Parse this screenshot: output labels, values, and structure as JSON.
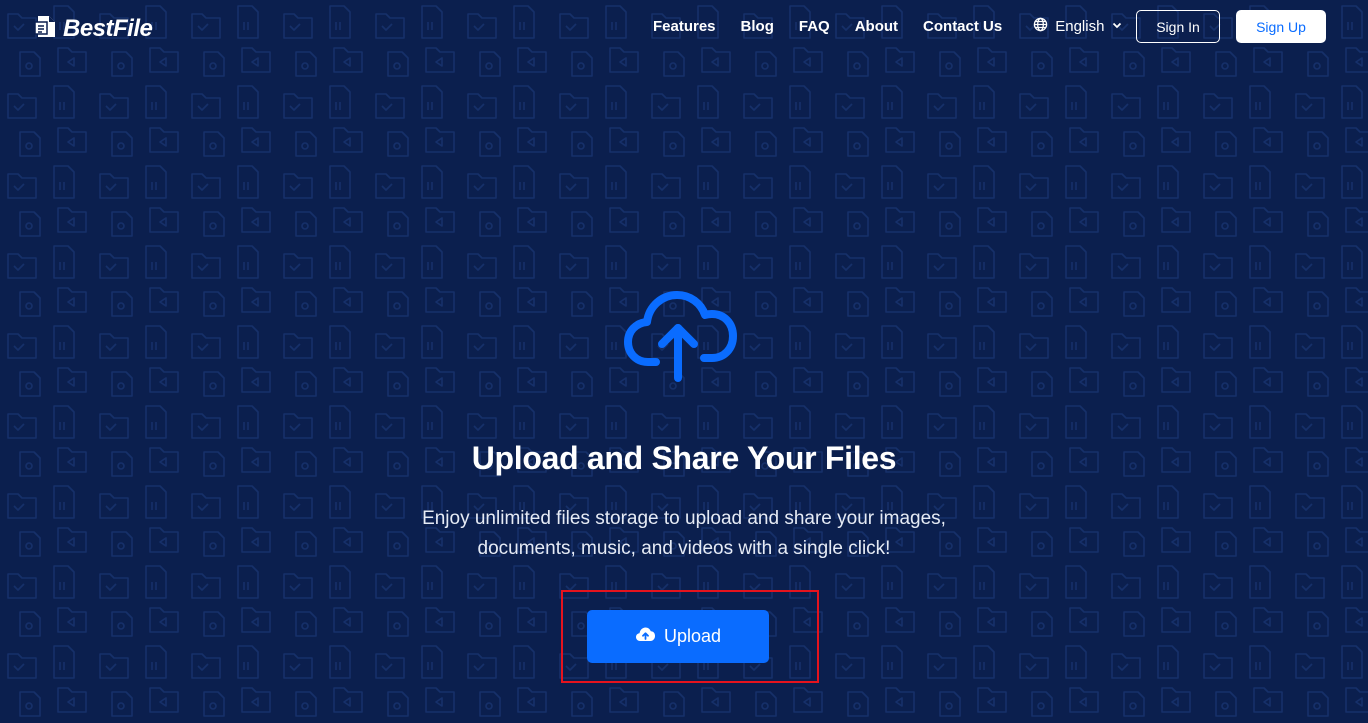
{
  "brand": {
    "name": "BestFile",
    "logo_icon": "file-logo-icon"
  },
  "nav": {
    "links": [
      "Features",
      "Blog",
      "FAQ",
      "About",
      "Contact Us"
    ],
    "language": "English",
    "language_icon": "globe-icon",
    "language_dropdown_icon": "chevron-down-icon"
  },
  "auth": {
    "sign_in": "Sign In",
    "sign_up": "Sign Up"
  },
  "hero": {
    "icon": "cloud-upload-icon",
    "title": "Upload and Share Your Files",
    "subtitle": "Enjoy unlimited files storage to upload and share your images, documents, music, and videos with a single click!",
    "upload_label": "Upload",
    "upload_icon": "cloud-upload-small-icon"
  },
  "colors": {
    "background": "#0b1f4e",
    "accent": "#0a6cff",
    "highlight": "#e5131d",
    "text": "#ffffff"
  }
}
